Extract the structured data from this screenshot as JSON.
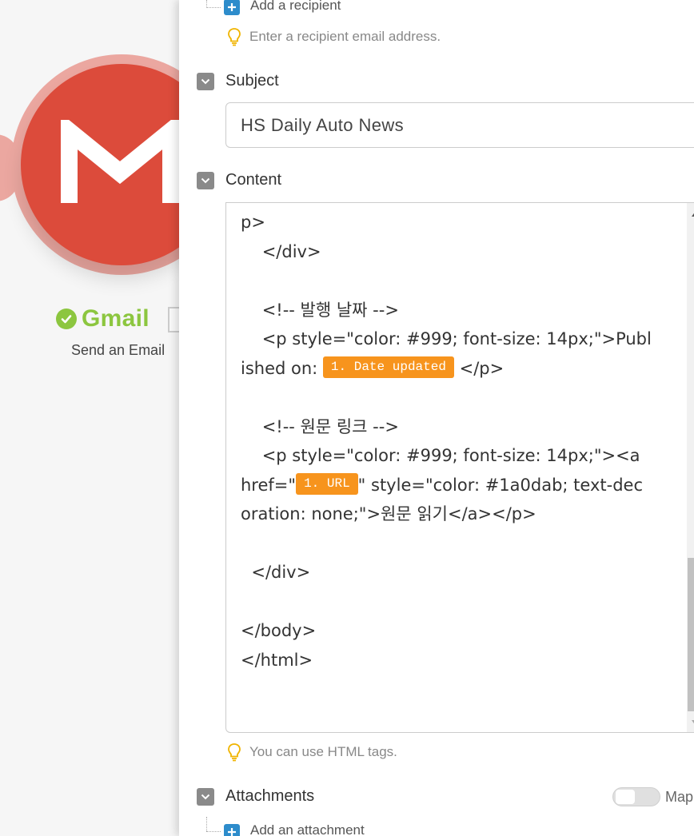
{
  "module": {
    "name": "Gmail",
    "subtitle": "Send an Email",
    "brand_color": "#dc4b3b",
    "status_color": "#8cc63f"
  },
  "recipients": {
    "add_label": "Add a recipient",
    "hint": "Enter a recipient email address."
  },
  "subject": {
    "title": "Subject",
    "value": "HS Daily Auto News"
  },
  "content": {
    "title": "Content",
    "lines": [
      "p>",
      "    </div>",
      "",
      "    <!-- 발행 날짜 -->",
      "    <p style=\"color: #999; font-size: 14px;\">Publ",
      "",
      "",
      "    <!-- 원문 링크 -->",
      "    <p style=\"color: #999; font-size: 14px;\"><a",
      "",
      "oration: none;\">원문 읽기</a></p>",
      "",
      "  </div>",
      "",
      "</body>",
      "</html>"
    ],
    "line_published_prefix": "ished on: ",
    "line_published_suffix": " </p>",
    "line_href_prefix": "href=\"",
    "line_href_suffix": "\" style=\"color: #1a0dab; text-dec",
    "pill_date": "1. Date updated",
    "pill_url": "1. URL",
    "pill_color": "#f7941d",
    "hint": "You can use HTML tags."
  },
  "attachments": {
    "title": "Attachments",
    "map_label": "Map",
    "add_label": "Add an attachment"
  }
}
